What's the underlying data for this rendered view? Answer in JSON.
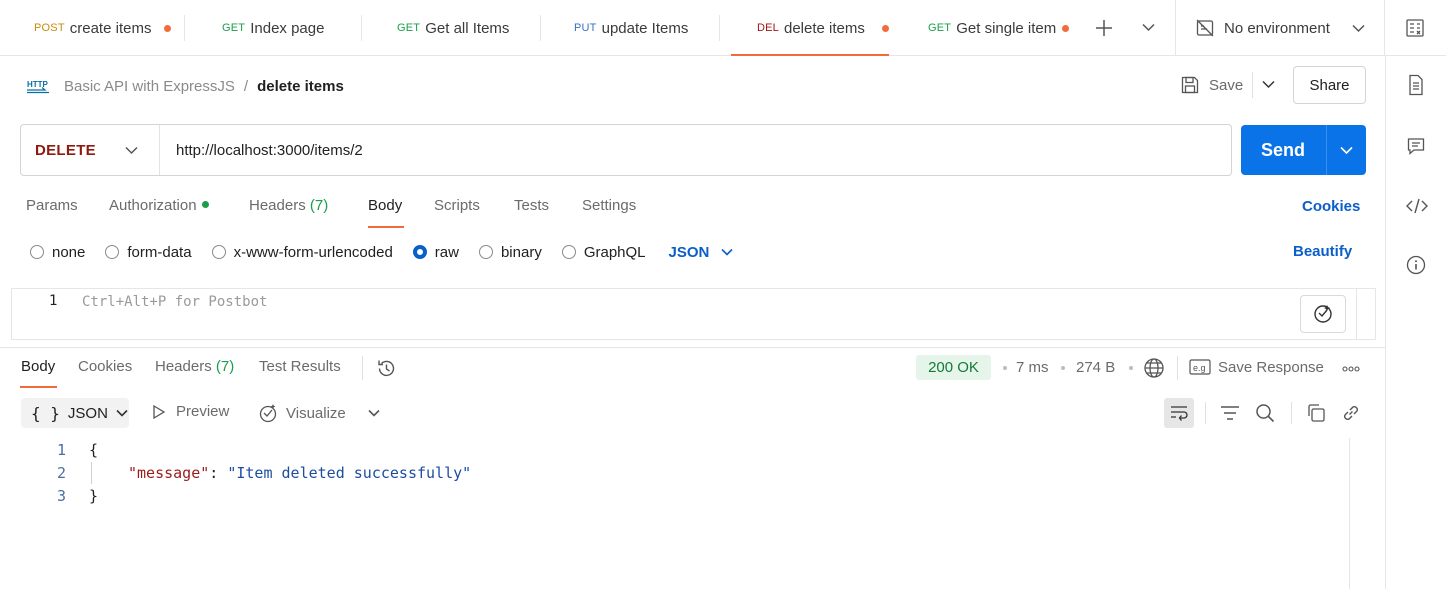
{
  "tabs": [
    {
      "method": "POST",
      "method_color": "#c98a0e",
      "name": "create items",
      "unsaved": true
    },
    {
      "method": "GET",
      "method_color": "#1a9e4a",
      "name": "Index page",
      "unsaved": false
    },
    {
      "method": "GET",
      "method_color": "#1a9e4a",
      "name": "Get all Items",
      "unsaved": false
    },
    {
      "method": "PUT",
      "method_color": "#3a6ec9",
      "name": "update Items",
      "unsaved": false
    },
    {
      "method": "DEL",
      "method_color": "#a31515",
      "name": "delete items",
      "unsaved": true,
      "active": true
    },
    {
      "method": "GET",
      "method_color": "#1a9e4a",
      "name": "Get single item",
      "unsaved": true
    }
  ],
  "environment": {
    "label": "No environment",
    "icon": "no-environment-icon"
  },
  "breadcrumb": {
    "icon": "http-icon",
    "parent": "Basic API with ExpressJS",
    "separator": "/",
    "current": "delete items"
  },
  "actions": {
    "save": "Save",
    "share": "Share"
  },
  "request": {
    "method": "DELETE",
    "url": "http://localhost:3000/items/2",
    "send": "Send"
  },
  "request_tabs": {
    "params": "Params",
    "authorization": "Authorization",
    "headers": "Headers",
    "headers_count": "(7)",
    "body": "Body",
    "scripts": "Scripts",
    "tests": "Tests",
    "settings": "Settings",
    "cookies": "Cookies",
    "active": "Body"
  },
  "body_types": {
    "options": [
      "none",
      "form-data",
      "x-www-form-urlencoded",
      "raw",
      "binary",
      "GraphQL"
    ],
    "selected": "raw",
    "format": "JSON",
    "beautify": "Beautify"
  },
  "editor": {
    "line_number": "1",
    "placeholder": "Ctrl+Alt+P for Postbot"
  },
  "response_tabs": {
    "body": "Body",
    "cookies": "Cookies",
    "headers": "Headers",
    "headers_count": "(7)",
    "test_results": "Test Results",
    "active": "Body"
  },
  "response_meta": {
    "status": "200 OK",
    "time": "7 ms",
    "size": "274 B",
    "save_response": "Save Response",
    "status_color": "#147a3a"
  },
  "response_toolbar": {
    "format": "JSON",
    "preview": "Preview",
    "visualize": "Visualize"
  },
  "response_body": {
    "line_numbers": [
      "1",
      "2",
      "3"
    ],
    "open_brace": "{",
    "key": "\"message\"",
    "colon": ":",
    "value": "\"Item deleted successfully\"",
    "close_brace": "}"
  },
  "colors": {
    "accent": "#f26b3a",
    "send": "#0a73e8",
    "link": "#0a5fc9"
  }
}
